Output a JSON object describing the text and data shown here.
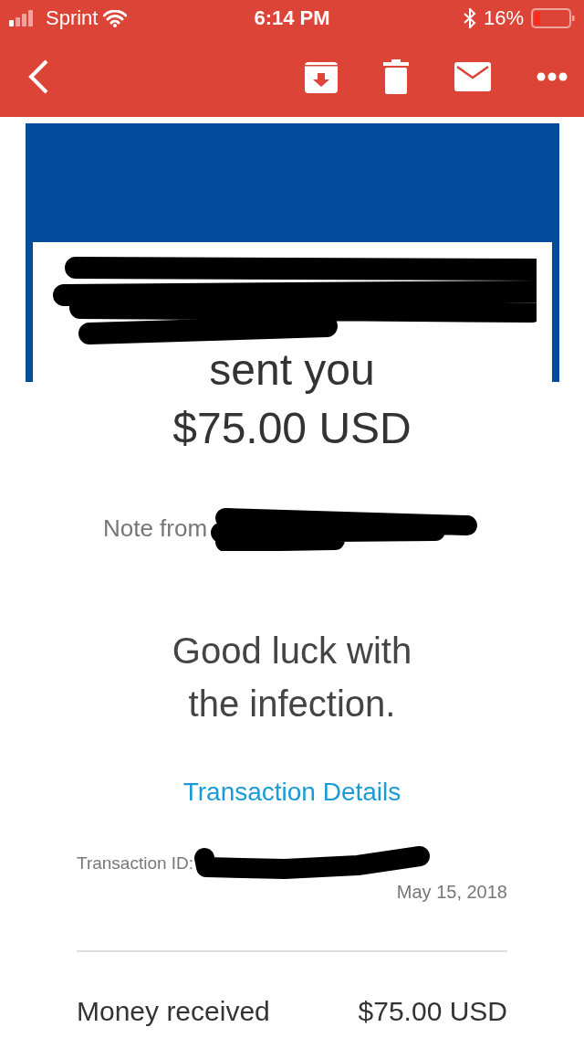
{
  "status_bar": {
    "carrier": "Sprint",
    "time": "6:14 PM",
    "battery": "16%"
  },
  "toolbar": {
    "actions": [
      {
        "kind": "archive"
      },
      {
        "kind": "delete"
      },
      {
        "kind": "mail"
      },
      {
        "kind": "more"
      }
    ]
  },
  "email": {
    "headline": [
      "sent you",
      "$75.00 USD"
    ],
    "note_label": "Note from",
    "note": [
      "Good luck with",
      "the infection."
    ],
    "link": "Transaction Details",
    "transaction_id_label": "Transaction ID:",
    "date": "May 15, 2018",
    "summary": {
      "label": "Money received",
      "amount": "$75.00 USD"
    }
  }
}
